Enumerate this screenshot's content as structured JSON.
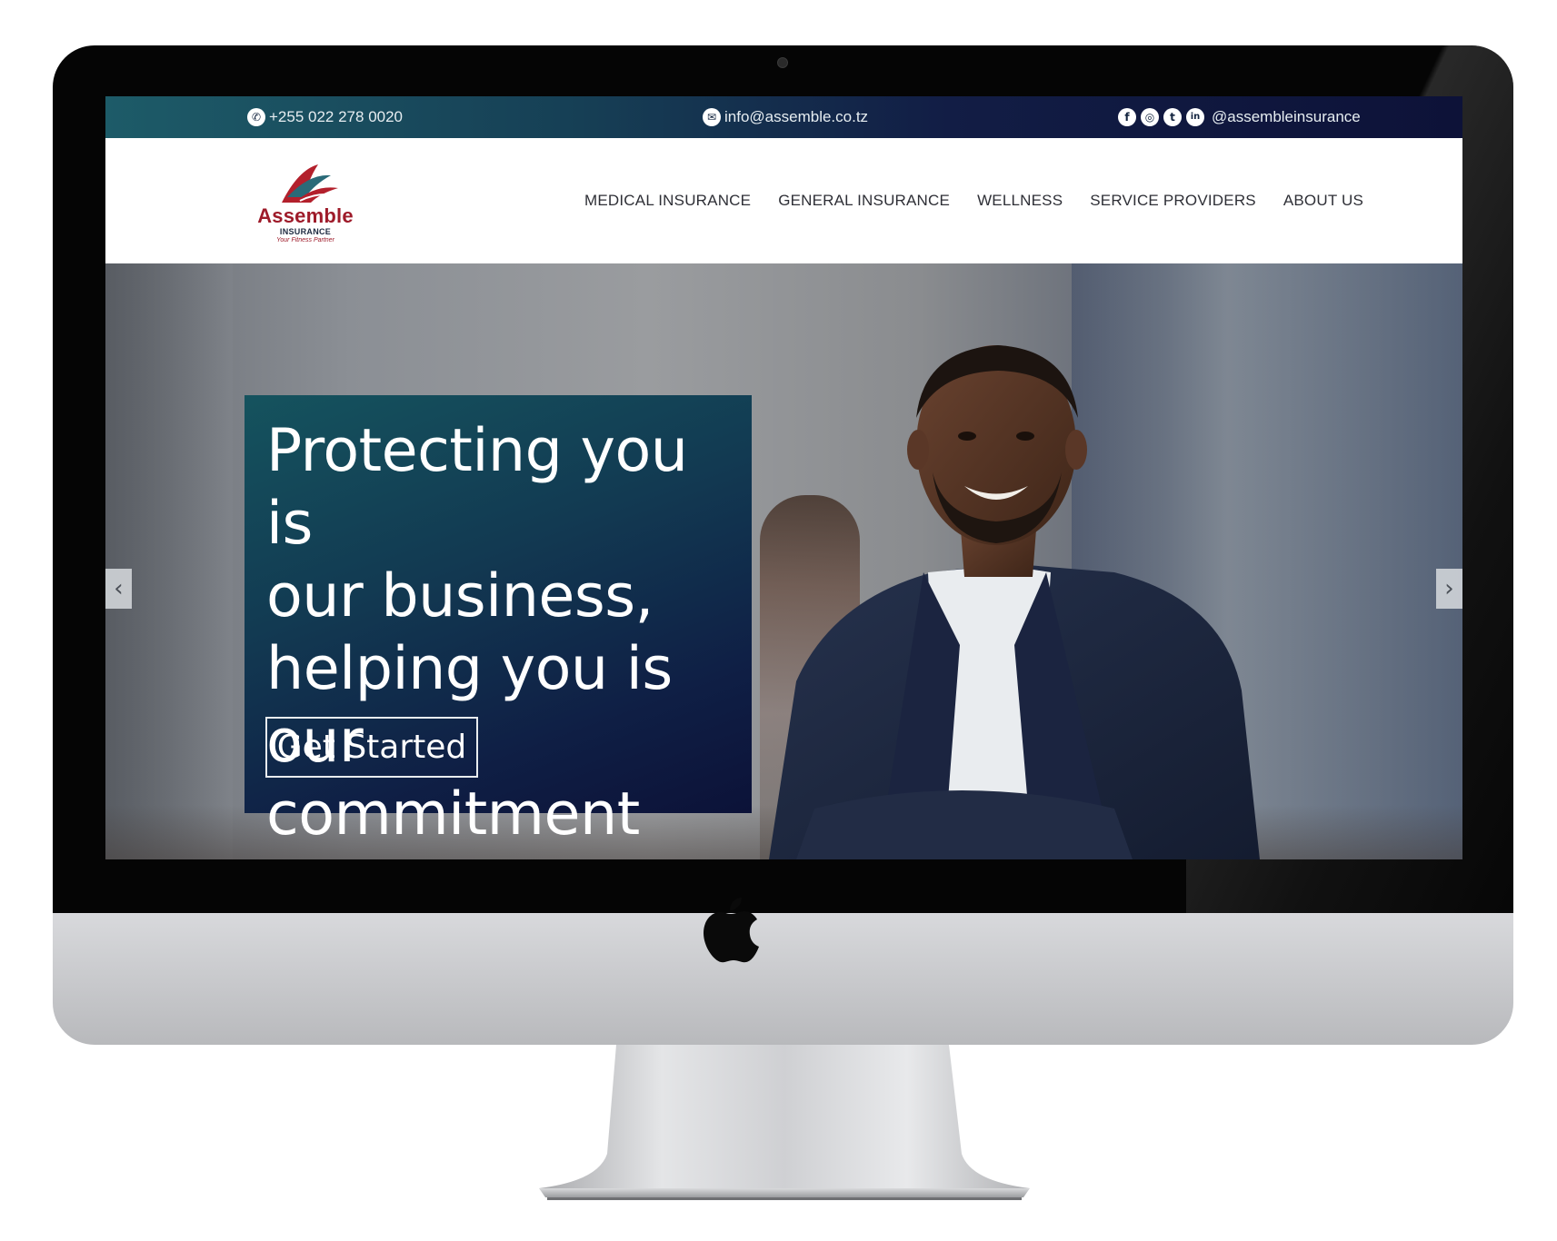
{
  "topbar": {
    "phone": "+255 022 278 0020",
    "email": "info@assemble.co.tz",
    "social_handle": "@assembleinsurance",
    "social_icons": [
      "facebook-icon",
      "instagram-icon",
      "twitter-icon",
      "linkedin-icon"
    ],
    "icon_glyphs": {
      "phone": "✆",
      "email": "✉",
      "facebook": "f",
      "instagram": "◎",
      "twitter": "t",
      "linkedin": "in"
    }
  },
  "logo": {
    "wordmark": "Assemble",
    "sub": "INSURANCE",
    "tagline": "Your Fitness Partner"
  },
  "nav": {
    "items": [
      {
        "label": "MEDICAL INSURANCE"
      },
      {
        "label": "GENERAL INSURANCE"
      },
      {
        "label": "WELLNESS"
      },
      {
        "label": "SERVICE PROVIDERS"
      },
      {
        "label": "ABOUT US"
      }
    ]
  },
  "hero": {
    "headline_lines": [
      "Protecting you is",
      "our business,",
      "helping you is our",
      "commitment"
    ],
    "cta_label": "Get Started",
    "prev_arrow": "‹",
    "next_arrow": "›"
  },
  "colors": {
    "topbar_start": "#1d5b68",
    "topbar_end": "#0d1238",
    "brand_red": "#9e1b2a",
    "overlay_start": "#15535e",
    "overlay_end": "#0c1238",
    "nav_text": "#2e2f36"
  }
}
